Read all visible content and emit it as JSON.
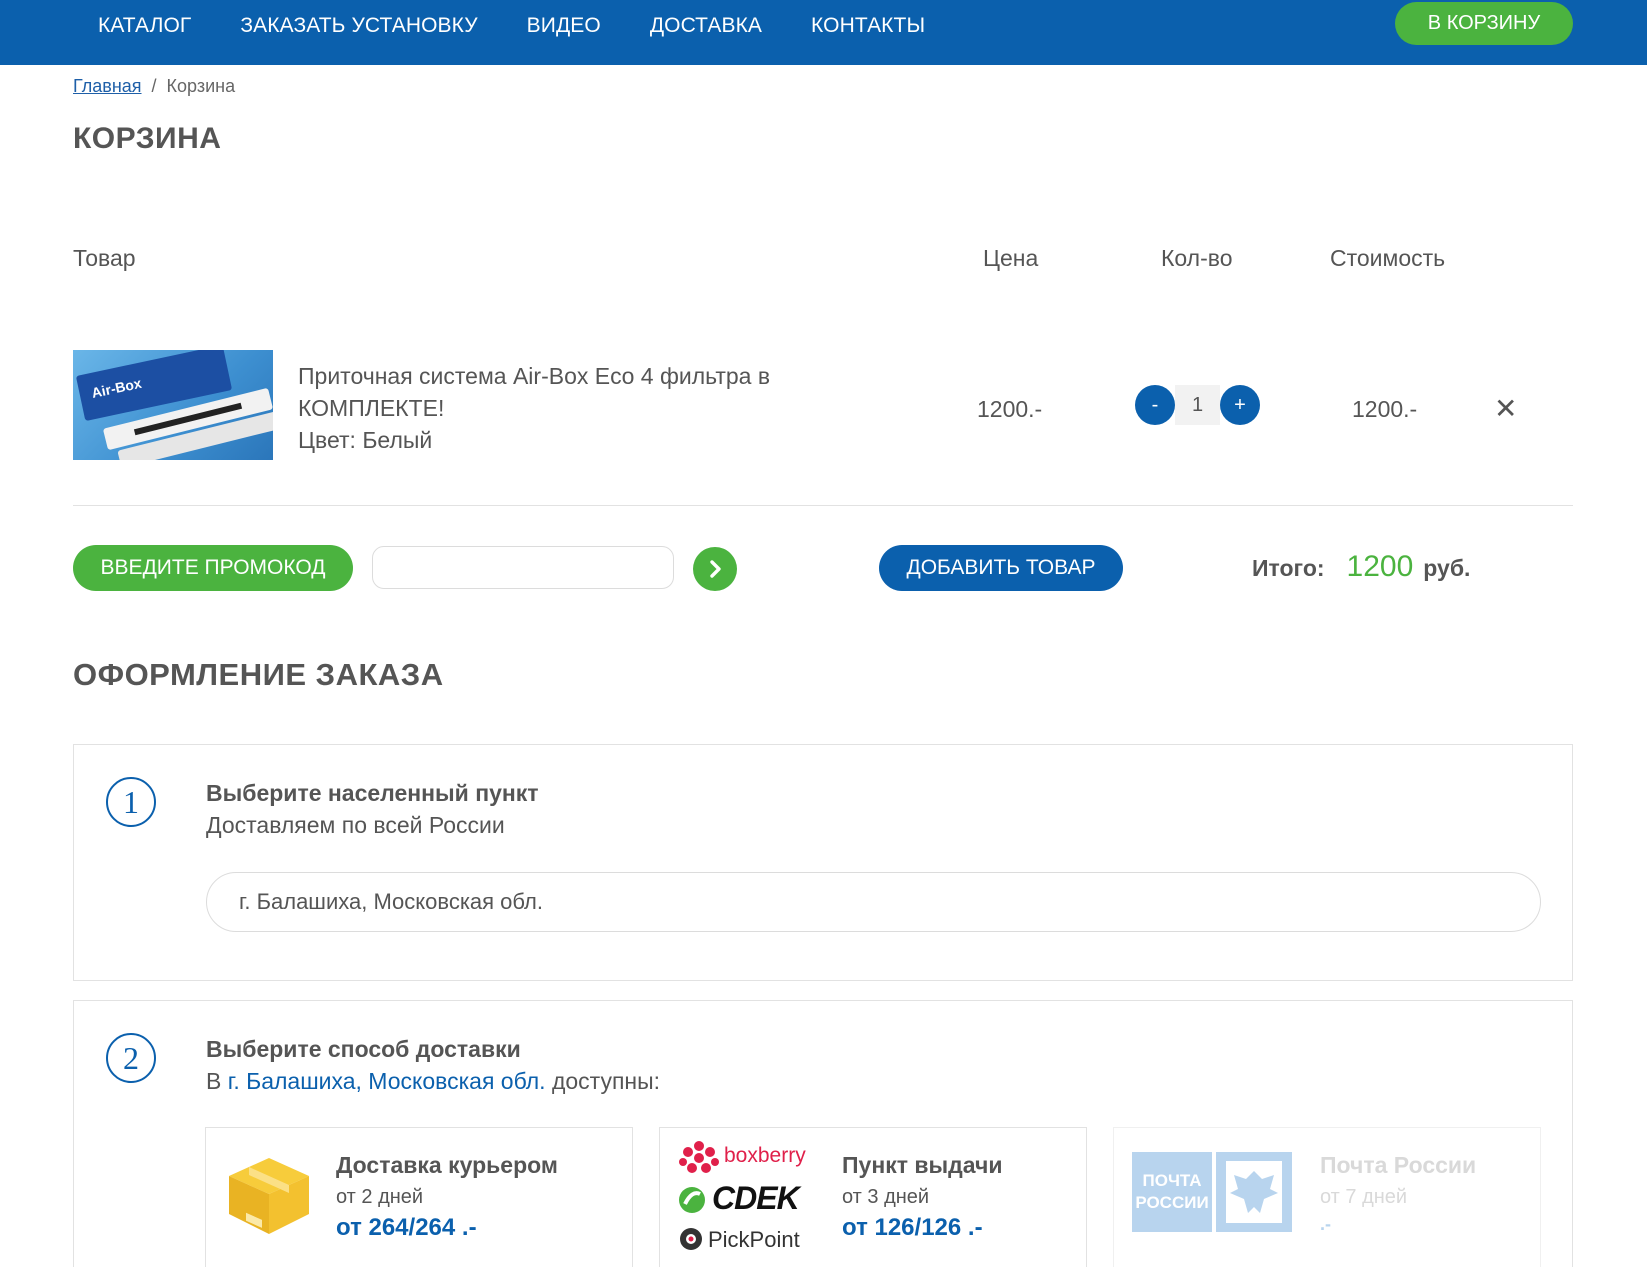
{
  "nav": {
    "items": [
      "КАТАЛОГ",
      "ЗАКАЗАТЬ УСТАНОВКУ",
      "ВИДЕО",
      "ДОСТАВКА",
      "КОНТАКТЫ"
    ],
    "cart_button": "В КОРЗИНУ"
  },
  "breadcrumb": {
    "home": "Главная",
    "sep": "/",
    "current": "Корзина"
  },
  "page_title": "КОРЗИНА",
  "table": {
    "headers": {
      "product": "Товар",
      "price": "Цена",
      "qty": "Кол-во",
      "cost": "Стоимость"
    },
    "row": {
      "image_label": "Air-Box",
      "name_line1": "Приточная система Air-Box Eco 4 фильтра в",
      "name_line2": "КОМПЛЕКТЕ!",
      "color_line": "Цвет: Белый",
      "price": "1200.-",
      "qty": "1",
      "minus": "-",
      "plus": "+",
      "cost": "1200.-",
      "remove": "✕"
    }
  },
  "promo": {
    "button": "ВВЕДИТЕ ПРОМОКОД",
    "input_value": "",
    "go": "›"
  },
  "add_button": "ДОБАВИТЬ ТОВАР",
  "total": {
    "label": "Итого:",
    "value": "1200",
    "currency": "руб."
  },
  "checkout_title": "ОФОРМЛЕНИЕ ЗАКАЗА",
  "step1": {
    "num": "1",
    "heading": "Выберите населенный пункт",
    "sub": "Доставляем по всей России",
    "city_value": "г. Балашиха, Московская обл."
  },
  "step2": {
    "num": "2",
    "heading": "Выберите способ доставки",
    "sub_prefix": "В",
    "sub_city": "г. Балашиха, Московская обл.",
    "sub_suffix": "доступны:",
    "options": [
      {
        "title": "Доставка курьером",
        "days": "от 2 дней",
        "price": "от 264/264 .-"
      },
      {
        "title": "Пункт выдачи",
        "days": "от 3 дней",
        "price": "от 126/126 .-",
        "logos": [
          "boxberry",
          "CDEK",
          "PickPoint"
        ]
      },
      {
        "title": "Почта России",
        "days": "от 7 дней",
        "price": ".-",
        "logo": "ПОЧТА РОССИИ"
      }
    ]
  },
  "colors": {
    "blue": "#0b60ad",
    "green": "#4bb33f"
  }
}
